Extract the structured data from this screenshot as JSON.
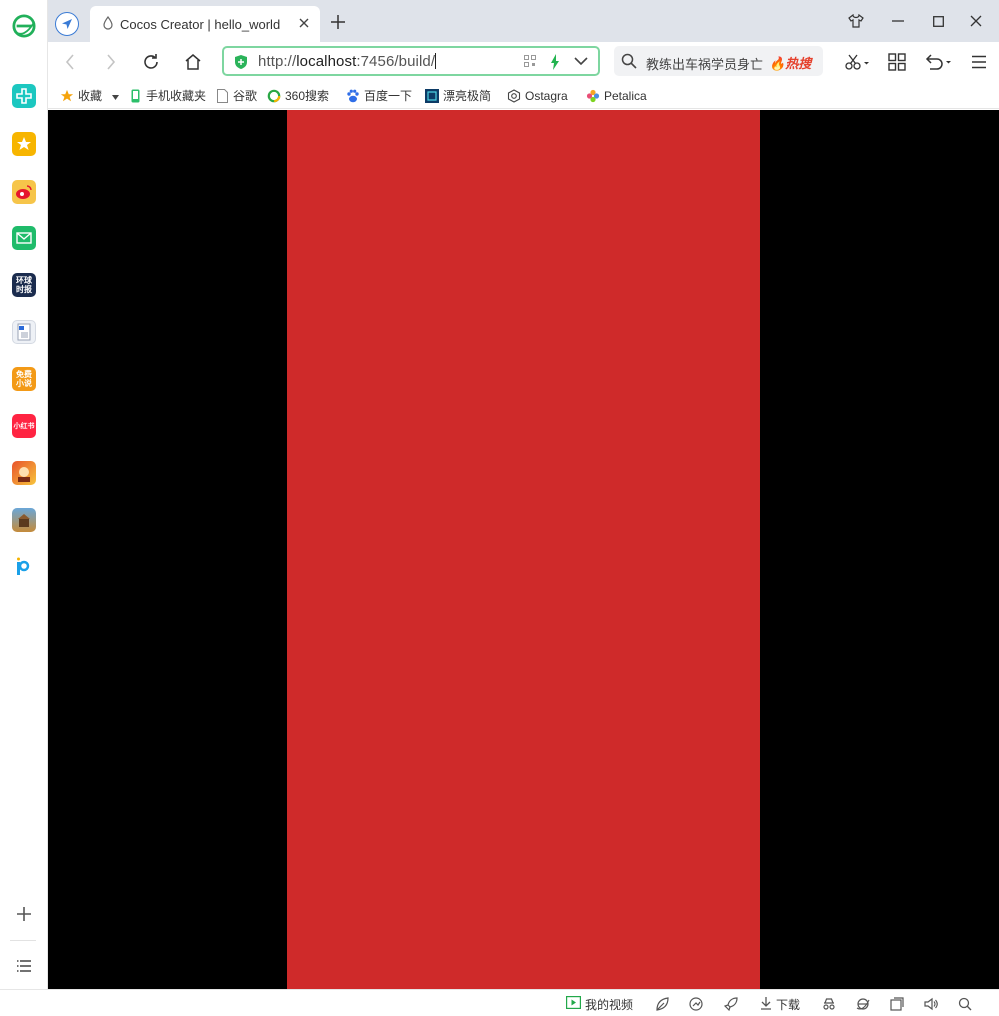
{
  "window": {
    "tab_title": "Cocos Creator | hello_world"
  },
  "toolbar": {
    "url_scheme": "http://",
    "url_host": "localhost",
    "url_rest": ":7456/build/",
    "search_text": "教练出车祸学员身亡",
    "hot_label": "热搜"
  },
  "bookmarks": [
    {
      "label": "收藏",
      "icon": "star-icon"
    },
    {
      "label": "手机收藏夹",
      "icon": "phone-icon"
    },
    {
      "label": "谷歌",
      "icon": "page-icon"
    },
    {
      "label": "360搜索",
      "icon": "search-360-icon"
    },
    {
      "label": "百度一下",
      "icon": "baidu-paw-icon"
    },
    {
      "label": "漂亮极简",
      "icon": "app-icon"
    },
    {
      "label": "Ostagra",
      "icon": "camera-icon"
    },
    {
      "label": "Petalica",
      "icon": "flower-icon"
    }
  ],
  "sidebar": [
    {
      "name": "browser-logo-icon"
    },
    {
      "name": "health-cross-icon"
    },
    {
      "name": "favorites-star-icon"
    },
    {
      "name": "weibo-icon"
    },
    {
      "name": "mail-icon"
    },
    {
      "name": "news-app-icon",
      "text": "环球时报"
    },
    {
      "name": "word-doc-icon"
    },
    {
      "name": "free-novel-icon",
      "text": "免费小说"
    },
    {
      "name": "xiaohongshu-icon",
      "text": "小红书"
    },
    {
      "name": "game-a-icon"
    },
    {
      "name": "game-b-icon"
    },
    {
      "name": "pinduoduo-icon"
    }
  ],
  "statusbar": {
    "my_video": "我的视频",
    "download": "下载"
  },
  "canvas": {
    "background": "#000000",
    "panel_color": "#cf2a2a"
  }
}
